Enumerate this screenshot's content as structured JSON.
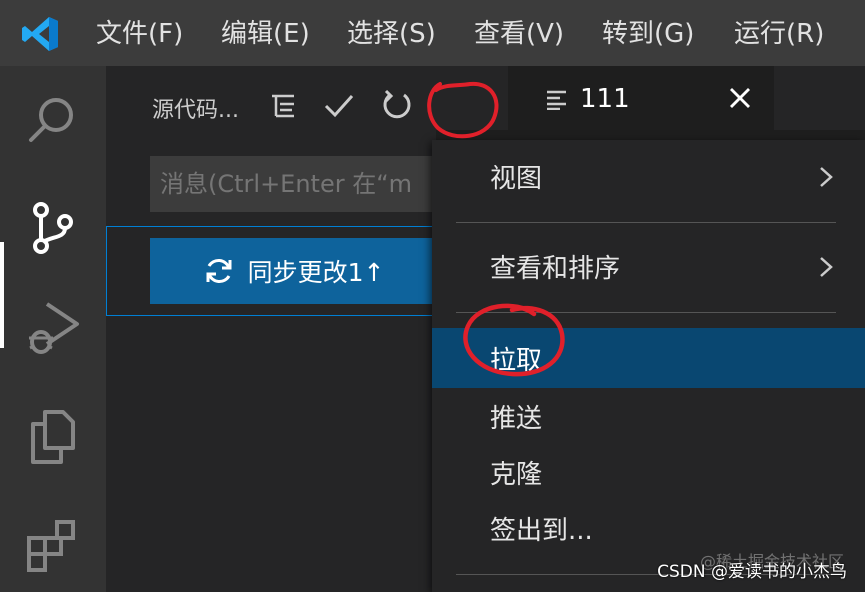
{
  "menubar": {
    "items": [
      "文件(F)",
      "编辑(E)",
      "选择(S)",
      "查看(V)",
      "转到(G)",
      "运行(R)"
    ]
  },
  "activitybar": {
    "icons": [
      "search-icon",
      "source-control-icon",
      "run-debug-icon",
      "explorer-icon",
      "extensions-icon"
    ],
    "active": "source-control-icon"
  },
  "sidebar": {
    "title": "源代码...",
    "header_icons": [
      "view-as-tree-icon",
      "commit-check-icon",
      "refresh-icon",
      "more-actions-icon"
    ],
    "message_placeholder": "消息(Ctrl+Enter 在“m",
    "sync_button_label": "同步更改1↑"
  },
  "editor": {
    "tab_label": "111",
    "tab_icon": "lines-icon"
  },
  "context_menu": {
    "items": [
      {
        "label": "视图",
        "submenu": true
      },
      {
        "label": "查看和排序",
        "submenu": true
      },
      {
        "label": "拉取",
        "submenu": false,
        "highlighted": true
      },
      {
        "label": "推送",
        "submenu": false
      },
      {
        "label": "克隆",
        "submenu": false
      },
      {
        "label": "签出到...",
        "submenu": false
      }
    ]
  },
  "watermark": {
    "text": "CSDN @爱读书的小杰鸟",
    "faint_text": "@稀土掘金技术社区"
  },
  "colors": {
    "accent": "#0e639c",
    "menu_highlight": "#094771",
    "annotation": "#e0202a"
  }
}
